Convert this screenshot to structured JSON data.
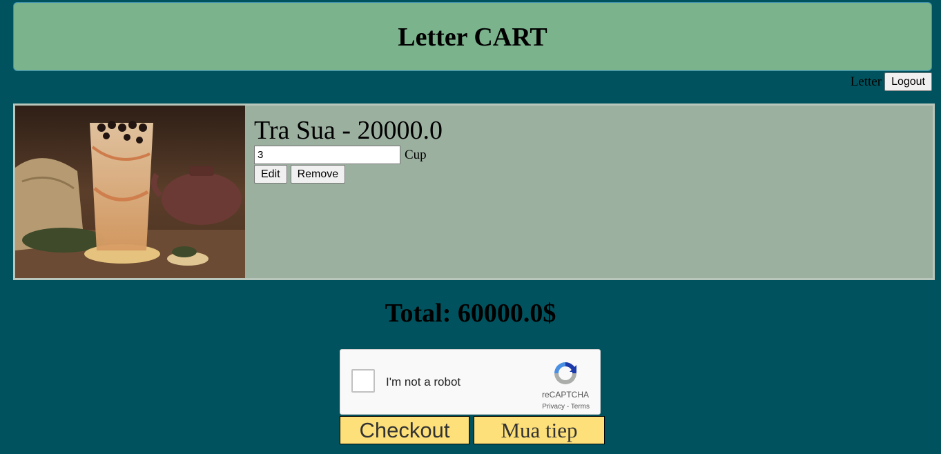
{
  "header": {
    "title": "Letter CART"
  },
  "userbar": {
    "username": "Letter",
    "logout_label": "Logout"
  },
  "cart": {
    "items": [
      {
        "title": "Tra Sua - 20000.0",
        "quantity": "3",
        "unit": "Cup",
        "edit_label": "Edit",
        "remove_label": "Remove"
      }
    ]
  },
  "total": {
    "text": "Total: 60000.0$"
  },
  "recaptcha": {
    "label": "I'm not a robot",
    "brand": "reCAPTCHA",
    "privacy": "Privacy",
    "separator": " - ",
    "terms": "Terms"
  },
  "actions": {
    "checkout_label": "Checkout",
    "continue_label": "Mua tiep"
  },
  "colors": {
    "background": "#00535e",
    "header": "#7bb38d",
    "item_panel": "#9cb0a0",
    "button_accent": "#fde07a"
  }
}
